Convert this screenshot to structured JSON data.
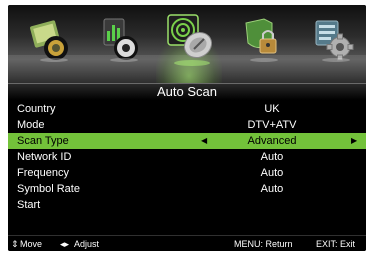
{
  "menu": {
    "title": "Auto Scan",
    "tabs": [
      {
        "name": "picture",
        "icon": "picture-icon"
      },
      {
        "name": "sound",
        "icon": "sound-icon"
      },
      {
        "name": "channel",
        "icon": "satellite-dish-icon",
        "active": true
      },
      {
        "name": "lock",
        "icon": "lock-icon"
      },
      {
        "name": "setup",
        "icon": "gear-icon"
      }
    ]
  },
  "rows": [
    {
      "label": "Country",
      "value": "UK"
    },
    {
      "label": "Mode",
      "value": "DTV+ATV"
    },
    {
      "label": "Scan Type",
      "value": "Advanced",
      "selected": true
    },
    {
      "label": "Network ID",
      "value": "Auto"
    },
    {
      "label": "Frequency",
      "value": "Auto"
    },
    {
      "label": "Symbol Rate",
      "value": "Auto"
    },
    {
      "label": "Start",
      "value": ""
    }
  ],
  "footer": {
    "move": "Move",
    "adjust": "Adjust",
    "return_hint": "MENU: Return",
    "exit_hint": "EXIT: Exit"
  },
  "colors": {
    "selected_row": "#73c23a",
    "background": "#000000",
    "text": "#ffffff"
  }
}
